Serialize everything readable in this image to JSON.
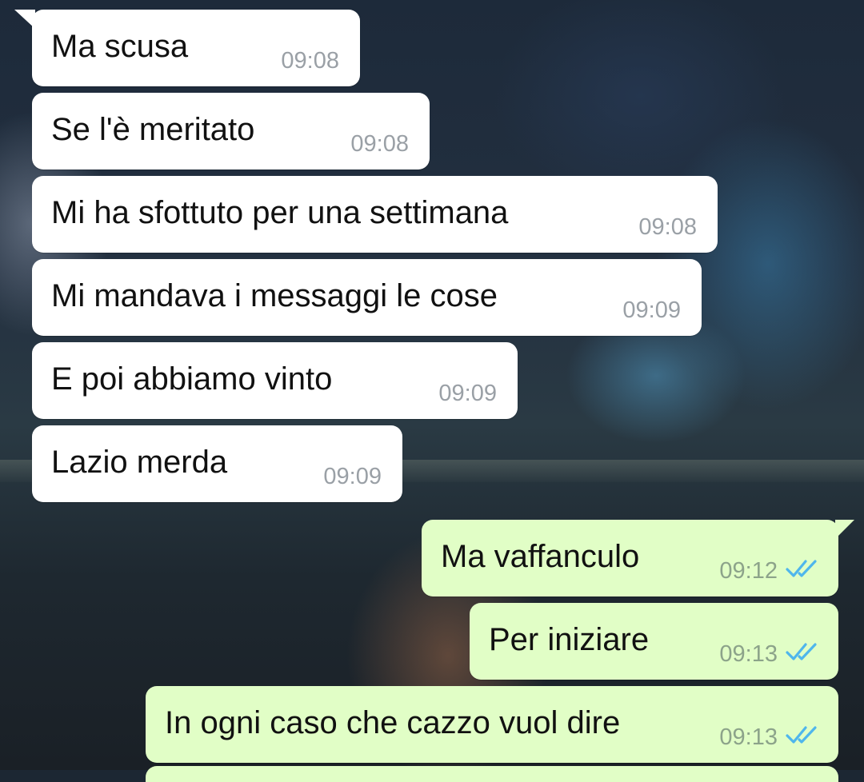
{
  "messages": [
    {
      "dir": "in",
      "text": "Ma scusa",
      "time": "09:08"
    },
    {
      "dir": "in",
      "text": "Se l'è meritato",
      "time": "09:08"
    },
    {
      "dir": "in",
      "text": "Mi ha sfottuto per una settimana",
      "time": "09:08"
    },
    {
      "dir": "in",
      "text": "Mi mandava i messaggi le cose",
      "time": "09:09"
    },
    {
      "dir": "in",
      "text": "E poi abbiamo vinto",
      "time": "09:09"
    },
    {
      "dir": "in",
      "text": "Lazio merda",
      "time": "09:09"
    },
    {
      "dir": "out",
      "text": "Ma vaffanculo",
      "time": "09:12",
      "status": "read"
    },
    {
      "dir": "out",
      "text": "Per iniziare",
      "time": "09:13",
      "status": "read"
    },
    {
      "dir": "out",
      "text": "In ogni caso che cazzo vuol dire",
      "time": "09:13",
      "status": "read"
    }
  ],
  "icons": {
    "read_status": "double-check-icon"
  },
  "colors": {
    "incoming_bubble": "#ffffff",
    "outgoing_bubble": "#e1fec6",
    "read_ticks": "#4fb6ec",
    "timestamp": "#9aa0a6"
  }
}
